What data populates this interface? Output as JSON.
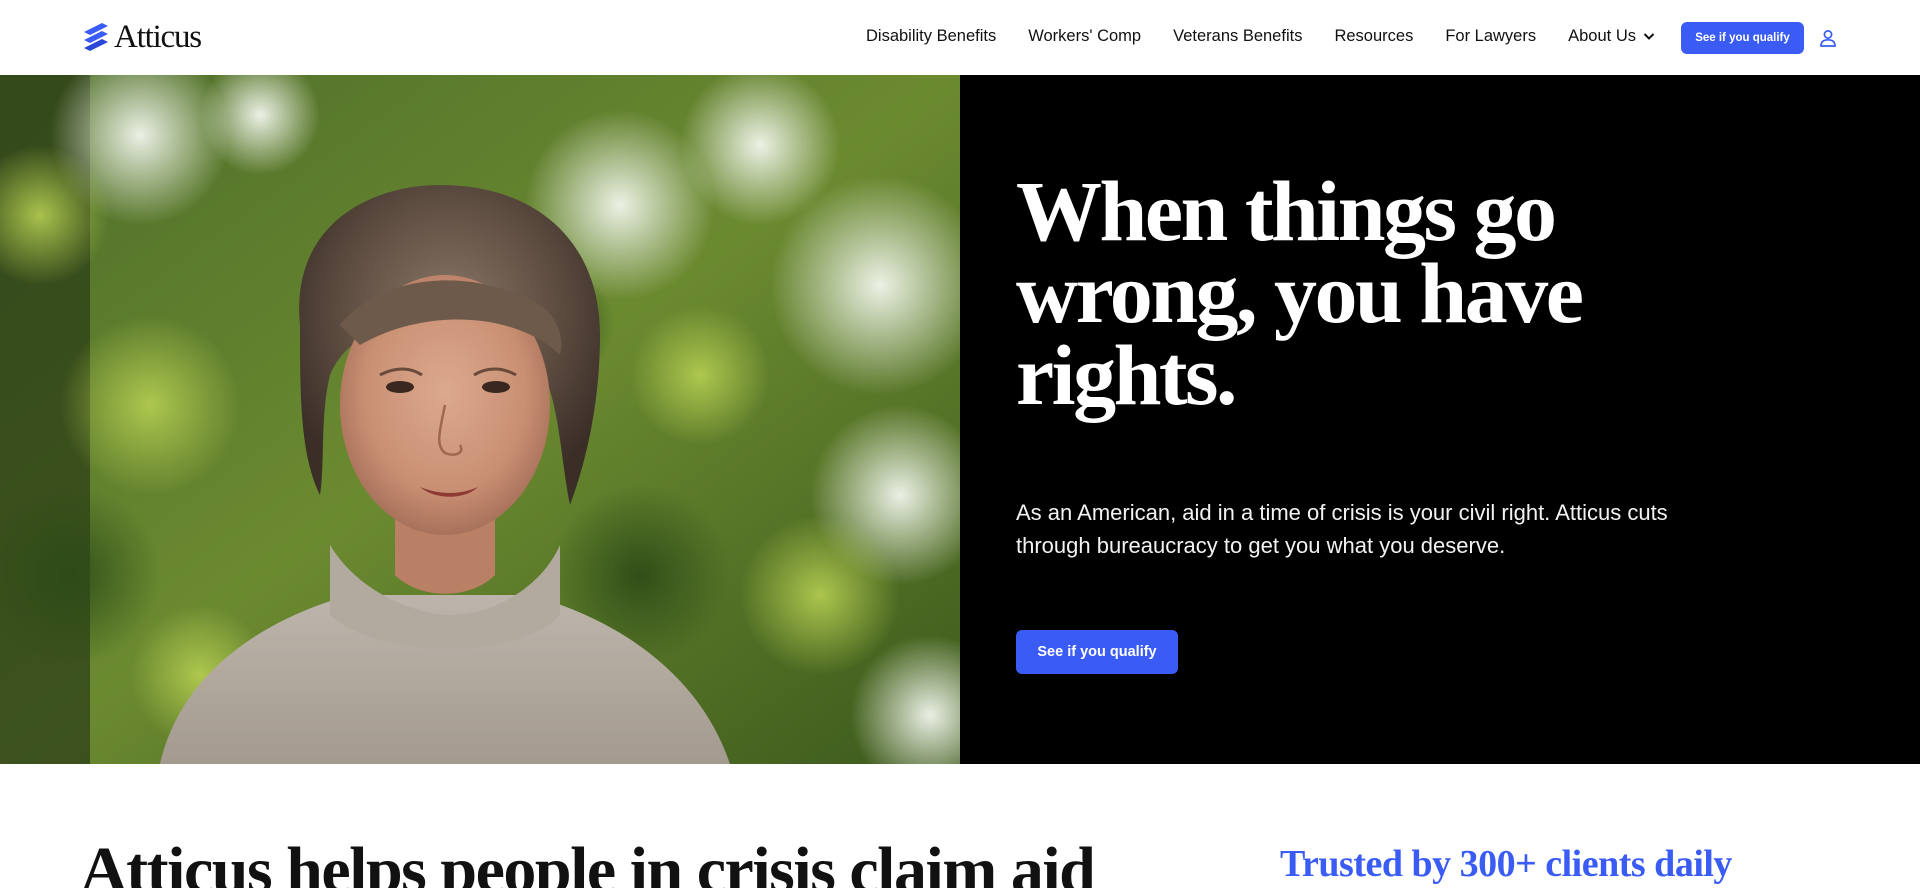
{
  "header": {
    "logo_text": "Atticus",
    "nav": [
      {
        "label": "Disability Benefits"
      },
      {
        "label": "Workers' Comp"
      },
      {
        "label": "Veterans Benefits"
      },
      {
        "label": "Resources"
      },
      {
        "label": "For Lawyers"
      },
      {
        "label": "About Us"
      }
    ],
    "cta_label": "See if you qualify"
  },
  "hero": {
    "title": "When things go wrong, you have rights.",
    "subtitle": "As an American, aid in a time of crisis is your civil right. Atticus cuts through bureaucracy to get you what you deserve.",
    "cta_label": "See if you qualify"
  },
  "section": {
    "title": "Atticus helps people in crisis claim aid",
    "trusted": "Trusted by 300+ clients daily"
  },
  "colors": {
    "accent": "#3a5cf5",
    "hero_bg": "#000000"
  },
  "icons": {
    "logo": "atticus-logo-icon",
    "dropdown": "chevron-down-icon",
    "account": "user-icon"
  }
}
